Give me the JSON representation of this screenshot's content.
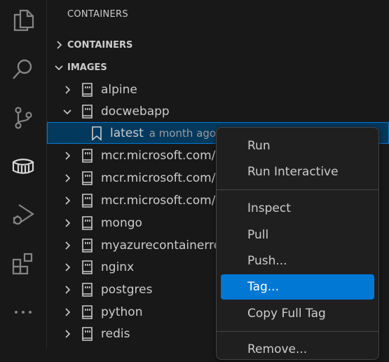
{
  "sidebar": {
    "title": "CONTAINERS",
    "sections": [
      {
        "label": "CONTAINERS",
        "expanded": false
      },
      {
        "label": "IMAGES",
        "expanded": true
      }
    ],
    "images": [
      {
        "label": "alpine",
        "expanded": false
      },
      {
        "label": "docwebapp",
        "expanded": true
      },
      {
        "label": "latest",
        "description": "a month ago",
        "selected": true
      },
      {
        "label": "mcr.microsoft.com/d",
        "expanded": false
      },
      {
        "label": "mcr.microsoft.com/d",
        "expanded": false
      },
      {
        "label": "mcr.microsoft.com/d",
        "expanded": false
      },
      {
        "label": "mongo",
        "expanded": false
      },
      {
        "label": "myazurecontainerre",
        "expanded": false
      },
      {
        "label": "nginx",
        "expanded": false
      },
      {
        "label": "postgres",
        "expanded": false
      },
      {
        "label": "python",
        "expanded": false
      },
      {
        "label": "redis",
        "expanded": false
      }
    ]
  },
  "context_menu": {
    "items": [
      "Run",
      "Run Interactive",
      "Inspect",
      "Pull",
      "Push...",
      "Tag...",
      "Copy Full Tag",
      "Remove..."
    ],
    "active": "Tag..."
  },
  "activity_bar": {
    "icons": [
      "explorer-icon",
      "search-icon",
      "source-control-icon",
      "containers-icon",
      "run-debug-icon",
      "extensions-icon",
      "more-icon"
    ]
  },
  "colors": {
    "background": "#181818",
    "selection": "#04395e",
    "accent": "#0078d4",
    "menu_bg": "#1f1f1f"
  }
}
